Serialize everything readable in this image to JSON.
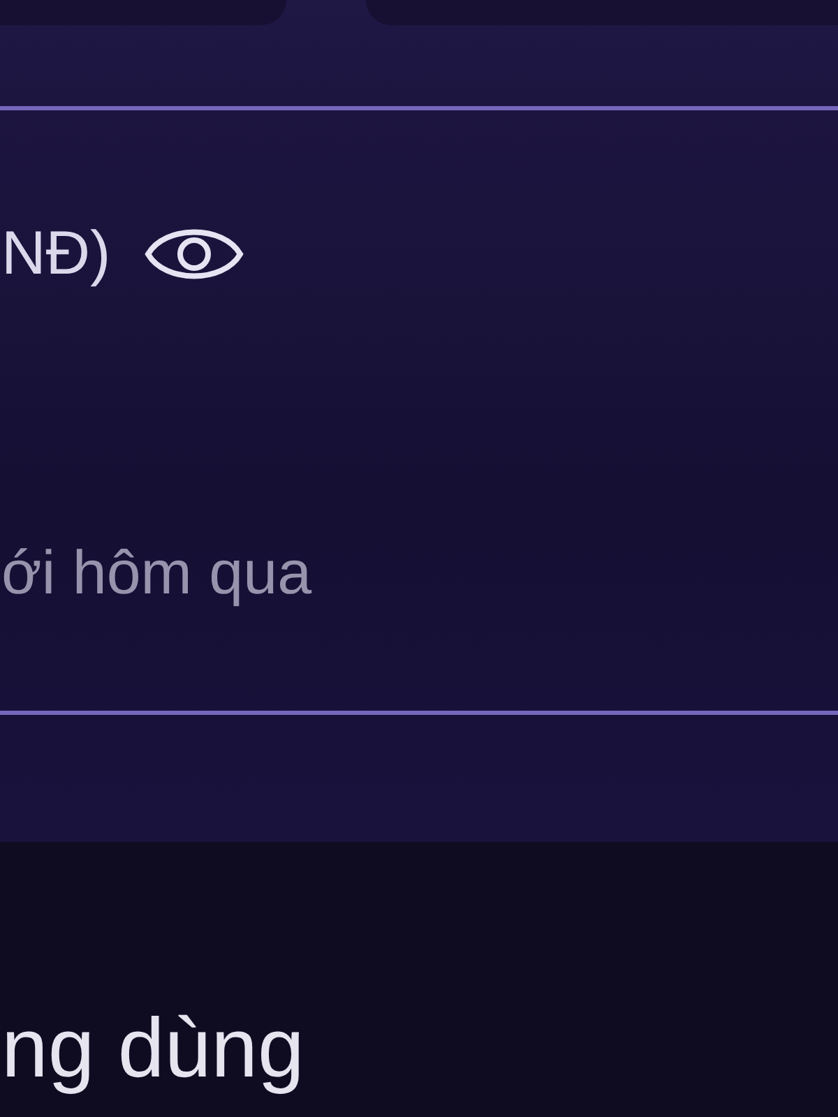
{
  "balance": {
    "label": "NĐ)",
    "comparison": "ới hôm qua"
  },
  "section": {
    "title": "ng dùng"
  }
}
